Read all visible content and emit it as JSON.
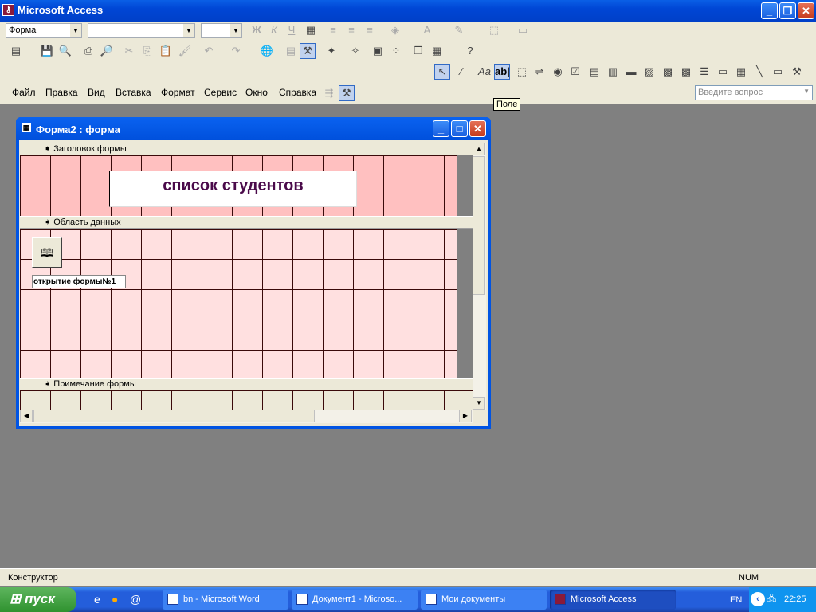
{
  "app": {
    "title": "Microsoft Access"
  },
  "toolbar_format": {
    "object_combo": "Форма",
    "font_combo": "",
    "size_combo": "",
    "bold": "Ж",
    "italic": "К",
    "underline": "Ч"
  },
  "menu": {
    "items": [
      "Файл",
      "Правка",
      "Вид",
      "Вставка",
      "Формат",
      "Сервис",
      "Окно",
      "Справка"
    ]
  },
  "ask_question": {
    "placeholder": "Введите вопрос"
  },
  "tooltip": "Поле",
  "form_window": {
    "title": "Форма2 : форма",
    "sections": {
      "header": "Заголовок формы",
      "detail": "Область данных",
      "footer": "Примечание формы"
    },
    "header_label": "список студентов",
    "button_caption": "открытие формы№1",
    "colors": {
      "header_bg": "#ffc0c0",
      "detail_bg": "#ffe0e0",
      "title_text": "#4a0a4a"
    }
  },
  "status": {
    "left": "Конструктор",
    "num": "NUM"
  },
  "taskbar": {
    "start": "пуск",
    "tasks": [
      "bn - Microsoft Word",
      "Документ1 - Microso...",
      "Мои документы",
      "Microsoft Access"
    ],
    "lang": "EN",
    "clock": "22:25"
  }
}
